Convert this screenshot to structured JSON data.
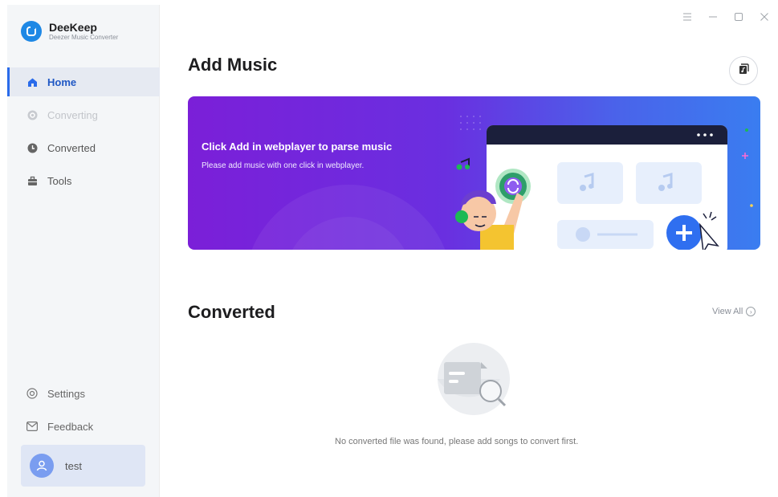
{
  "app": {
    "name": "DeeKeep",
    "subtitle": "Deezer Music Converter"
  },
  "window_controls": {
    "menu_icon": "menu-icon",
    "minimize_icon": "minimize-icon",
    "maximize_icon": "maximize-icon",
    "close_icon": "close-icon"
  },
  "sidebar": {
    "items": [
      {
        "label": "Home",
        "icon": "home-icon",
        "state": "active"
      },
      {
        "label": "Converting",
        "icon": "converting-icon",
        "state": "disabled"
      },
      {
        "label": "Converted",
        "icon": "clock-icon",
        "state": "normal"
      },
      {
        "label": "Tools",
        "icon": "toolbox-icon",
        "state": "normal"
      }
    ],
    "bottom_items": [
      {
        "label": "Settings",
        "icon": "gear-icon"
      },
      {
        "label": "Feedback",
        "icon": "mail-icon"
      }
    ],
    "user": {
      "name": "test",
      "icon": "user-avatar-icon"
    }
  },
  "main": {
    "add_music_title": "Add Music",
    "banner": {
      "title": "Click Add in webplayer to parse music",
      "subtitle": "Please add music with one click in webplayer."
    },
    "converted_title": "Converted",
    "view_all": "View All",
    "empty_message": "No converted file was found, please add songs to convert first."
  },
  "colors": {
    "accent": "#2a6bea",
    "banner_start": "#7b1fd8",
    "banner_end": "#3a7df0",
    "sidebar_bg": "#f4f6f8"
  }
}
